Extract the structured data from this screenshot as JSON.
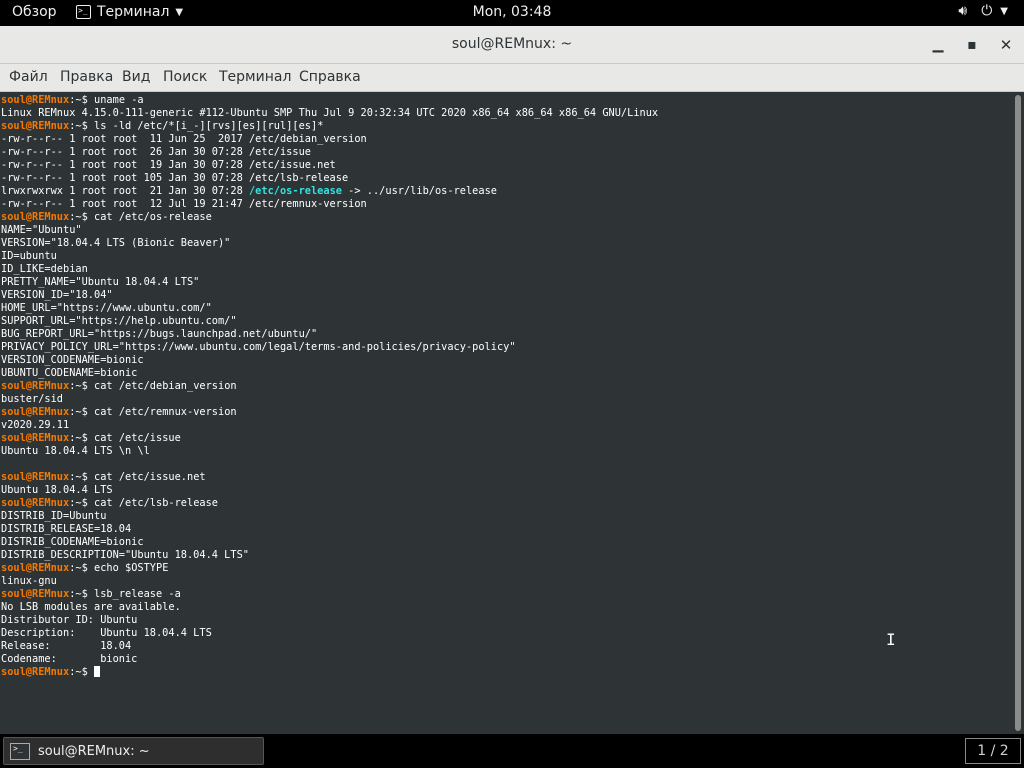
{
  "topbar": {
    "activities": "Обзор",
    "app_menu": "Терминал",
    "clock": "Mon, 03:48",
    "icons": [
      "volume-icon",
      "power-icon",
      "chevron-down-icon"
    ]
  },
  "window": {
    "title": "soul@REMnux: ~"
  },
  "menubar": {
    "items": [
      "Файл",
      "Правка",
      "Вид",
      "Поиск",
      "Терминал",
      "Справка"
    ]
  },
  "prompt": {
    "user_host": "soul@REMnux",
    "path": ":~",
    "symbol": "$ "
  },
  "terminal_lines": [
    {
      "t": "p",
      "c": "uname -a"
    },
    {
      "t": "o",
      "c": "Linux REMnux 4.15.0-111-generic #112-Ubuntu SMP Thu Jul 9 20:32:34 UTC 2020 x86_64 x86_64 x86_64 GNU/Linux"
    },
    {
      "t": "p",
      "c": "ls -ld /etc/*[i_-][rvs][es][rul][es]*"
    },
    {
      "t": "o",
      "c": "-rw-r--r-- 1 root root  11 Jun 25  2017 /etc/debian_version"
    },
    {
      "t": "o",
      "c": "-rw-r--r-- 1 root root  26 Jan 30 07:28 /etc/issue"
    },
    {
      "t": "o",
      "c": "-rw-r--r-- 1 root root  19 Jan 30 07:28 /etc/issue.net"
    },
    {
      "t": "o",
      "c": "-rw-r--r-- 1 root root 105 Jan 30 07:28 /etc/lsb-release"
    },
    {
      "t": "l",
      "c": "lrwxrwxrwx 1 root root  21 Jan 30 07:28 ",
      "link": "/etc/os-release",
      "rest": " -> ../usr/lib/os-release"
    },
    {
      "t": "o",
      "c": "-rw-r--r-- 1 root root  12 Jul 19 21:47 /etc/remnux-version"
    },
    {
      "t": "p",
      "c": "cat /etc/os-release"
    },
    {
      "t": "o",
      "c": "NAME=\"Ubuntu\""
    },
    {
      "t": "o",
      "c": "VERSION=\"18.04.4 LTS (Bionic Beaver)\""
    },
    {
      "t": "o",
      "c": "ID=ubuntu"
    },
    {
      "t": "o",
      "c": "ID_LIKE=debian"
    },
    {
      "t": "o",
      "c": "PRETTY_NAME=\"Ubuntu 18.04.4 LTS\""
    },
    {
      "t": "o",
      "c": "VERSION_ID=\"18.04\""
    },
    {
      "t": "o",
      "c": "HOME_URL=\"https://www.ubuntu.com/\""
    },
    {
      "t": "o",
      "c": "SUPPORT_URL=\"https://help.ubuntu.com/\""
    },
    {
      "t": "o",
      "c": "BUG_REPORT_URL=\"https://bugs.launchpad.net/ubuntu/\""
    },
    {
      "t": "o",
      "c": "PRIVACY_POLICY_URL=\"https://www.ubuntu.com/legal/terms-and-policies/privacy-policy\""
    },
    {
      "t": "o",
      "c": "VERSION_CODENAME=bionic"
    },
    {
      "t": "o",
      "c": "UBUNTU_CODENAME=bionic"
    },
    {
      "t": "p",
      "c": "cat /etc/debian_version"
    },
    {
      "t": "o",
      "c": "buster/sid"
    },
    {
      "t": "p",
      "c": "cat /etc/remnux-version"
    },
    {
      "t": "o",
      "c": "v2020.29.11"
    },
    {
      "t": "p",
      "c": "cat /etc/issue"
    },
    {
      "t": "o",
      "c": "Ubuntu 18.04.4 LTS \\n \\l"
    },
    {
      "t": "o",
      "c": ""
    },
    {
      "t": "p",
      "c": "cat /etc/issue.net"
    },
    {
      "t": "o",
      "c": "Ubuntu 18.04.4 LTS"
    },
    {
      "t": "p",
      "c": "cat /etc/lsb-release"
    },
    {
      "t": "o",
      "c": "DISTRIB_ID=Ubuntu"
    },
    {
      "t": "o",
      "c": "DISTRIB_RELEASE=18.04"
    },
    {
      "t": "o",
      "c": "DISTRIB_CODENAME=bionic"
    },
    {
      "t": "o",
      "c": "DISTRIB_DESCRIPTION=\"Ubuntu 18.04.4 LTS\""
    },
    {
      "t": "p",
      "c": "echo $OSTYPE"
    },
    {
      "t": "o",
      "c": "linux-gnu"
    },
    {
      "t": "p",
      "c": "lsb_release -a"
    },
    {
      "t": "o",
      "c": "No LSB modules are available."
    },
    {
      "t": "o",
      "c": "Distributor ID: Ubuntu"
    },
    {
      "t": "o",
      "c": "Description:    Ubuntu 18.04.4 LTS"
    },
    {
      "t": "o",
      "c": "Release:        18.04"
    },
    {
      "t": "o",
      "c": "Codename:       bionic"
    },
    {
      "t": "c",
      "c": ""
    }
  ],
  "taskbar": {
    "task_label": "soul@REMnux: ~",
    "workspace": "1 / 2"
  }
}
